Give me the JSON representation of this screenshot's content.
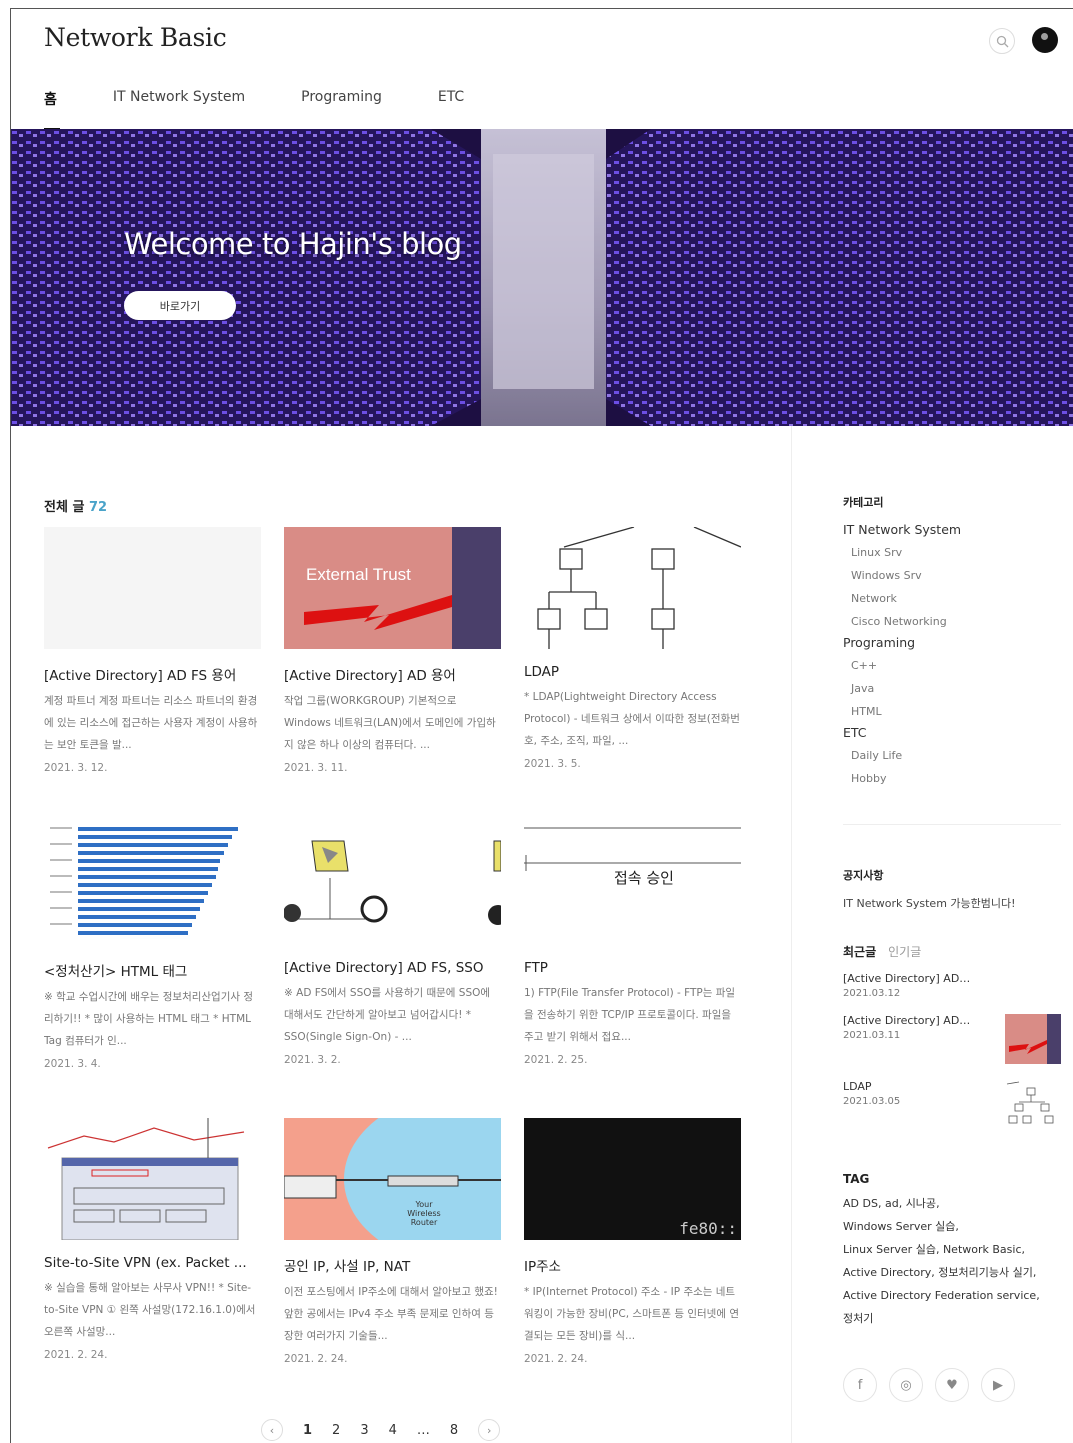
{
  "header": {
    "site_title": "Network Basic"
  },
  "nav": [
    {
      "label": "홈",
      "active": true
    },
    {
      "label": "IT Network System",
      "active": false
    },
    {
      "label": "Programing",
      "active": false
    },
    {
      "label": "ETC",
      "active": false
    }
  ],
  "hero": {
    "title": "Welcome to Hajin's blog",
    "button_label": "바로가기"
  },
  "main": {
    "count_label": "전체 글",
    "count_value": "72"
  },
  "posts": [
    {
      "title": "[Active Directory] AD FS 용어",
      "desc": "계정 파트너 계정 파트너는 리소스 파트너의 환경에 있는 리소스에 접근하는 사용자 계정이 사용하는 보안 토큰을 발...",
      "date": "2021. 3. 12."
    },
    {
      "title": "[Active Directory] AD 용어",
      "desc": "작업 그룹(WORKGROUP) 기본적으로 Windows 네트워크(LAN)에서 도메인에 가입하지 않은 하나 이상의 컴퓨터다. ...",
      "date": "2021. 3. 11.",
      "thumb_text": "External Trust"
    },
    {
      "title": "LDAP",
      "desc": "* LDAP(Lightweight Directory Access Protocol) - 네트워크 상에서 이따한 정보(전화번호, 주소, 조직, 파일, ...",
      "date": "2021. 3. 5."
    },
    {
      "title": "<정처산기> HTML 태그",
      "desc": "※ 학교 수업시간에 배우는 정보처리산업기사 정리하기!! * 많이 사용하는 HTML 태그 * HTML Tag 컴퓨터가 인...",
      "date": "2021. 3. 4."
    },
    {
      "title": "[Active Directory] AD FS, SSO",
      "desc": "※ AD FS에서 SSO를 사용하기 때문에 SSO에 대해서도 간단하게 알아보고 넘어갑시다! * SSO(Single Sign-On) - ...",
      "date": "2021. 3. 2."
    },
    {
      "title": "FTP",
      "desc": "1) FTP(File Transfer Protocol) - FTP는 파일을 전송하기 위한 TCP/IP 프로토콜이다. 파일을 주고 받기 위해서 접요...",
      "date": "2021. 2. 25.",
      "thumb_text": "접속 승인"
    },
    {
      "title": "Site-to-Site VPN (ex. Packet ...",
      "desc": "※ 실습을 통해 알아보는 사무사 VPN!! * Site-to-Site VPN ① 왼쪽 사설망(172.16.1.0)에서 오른쪽 사설망...",
      "date": "2021. 2. 24."
    },
    {
      "title": "공인 IP, 사설 IP, NAT",
      "desc": "이전 포스팅에서 IP주소에 대해서 알아보고 했죠! 앞한 공에서는 IPv4 주소 부족 문제로 인하여 등장한 여러가지 기술들...",
      "date": "2021. 2. 24.",
      "thumb_text": "Your Wireless Router"
    },
    {
      "title": "IP주소",
      "desc": "* IP(Internet Protocol) 주소 - IP 주소는 네트워킹이 가능한 장비(PC, 스마트폰 등 인터넷에 연결되는 모든 장비)를 식...",
      "date": "2021. 2. 24.",
      "thumb_text": "fe80::"
    }
  ],
  "pager": {
    "prev": "‹",
    "next": "›",
    "pages": [
      "1",
      "2",
      "3",
      "4",
      "…",
      "8"
    ],
    "current": "1"
  },
  "sidebar": {
    "category_heading": "카테고리",
    "categories": [
      {
        "label": "IT Network System",
        "children": [
          "Linux Srv",
          "Windows Srv",
          "Network",
          "Cisco Networking"
        ]
      },
      {
        "label": "Programing",
        "children": [
          "C++",
          "Java",
          "HTML"
        ]
      },
      {
        "label": "ETC",
        "children": [
          "Daily Life",
          "Hobby"
        ]
      }
    ],
    "notice_heading": "공지사항",
    "notice_text": "IT Network System 가능한범니다!",
    "tabs": [
      "최근글",
      "인기글"
    ],
    "recent": [
      {
        "title": "[Active Directory] AD…",
        "date": "2021.03.12"
      },
      {
        "title": "[Active Directory] AD…",
        "date": "2021.03.11"
      },
      {
        "title": "LDAP",
        "date": "2021.03.05"
      }
    ],
    "tag_heading": "TAG",
    "tags": [
      "AD DS",
      "ad",
      "시나공",
      "Windows Server 실습",
      "Linux Server 실습",
      "Network Basic",
      "Active Directory",
      "정보처리기능사 실기",
      "Active Directory Federation service",
      "정처기"
    ],
    "social": [
      "f",
      "◎",
      "♥",
      "▶"
    ]
  }
}
